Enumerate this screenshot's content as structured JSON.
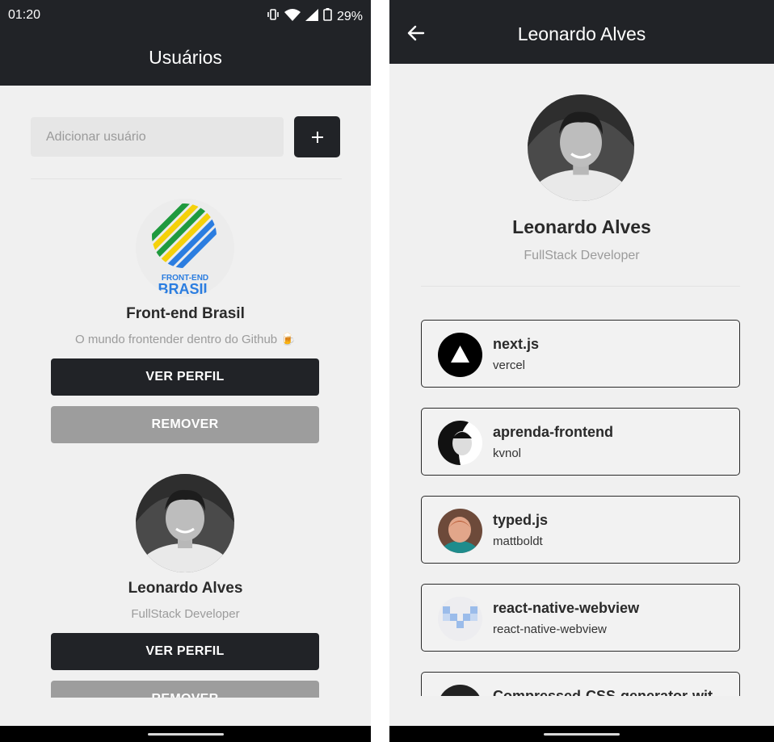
{
  "left": {
    "status": {
      "time": "01:20",
      "battery": "29%"
    },
    "title": "Usuários",
    "add_placeholder": "Adicionar usuário",
    "add_icon": "plus-icon",
    "users": [
      {
        "name": "Front-end Brasil",
        "description": "O mundo frontender dentro do Github 🍺",
        "view_label": "VER PERFIL",
        "remove_label": "REMOVER",
        "logo_text_1": "FRONT-END",
        "logo_text_2": "BRASIL"
      },
      {
        "name": "Leonardo Alves",
        "description": "FullStack Developer",
        "view_label": "VER PERFIL",
        "remove_label": "REMOVER"
      }
    ]
  },
  "right": {
    "title": "Leonardo Alves",
    "back_icon": "arrow-left-icon",
    "profile": {
      "name": "Leonardo Alves",
      "description": "FullStack Developer"
    },
    "repos": [
      {
        "name": "next.js",
        "owner": "vercel"
      },
      {
        "name": "aprenda-frontend",
        "owner": "kvnol"
      },
      {
        "name": "typed.js",
        "owner": "mattboldt"
      },
      {
        "name": "react-native-webview",
        "owner": "react-native-webview"
      },
      {
        "name": "Compressed-CSS-generator-wit",
        "owner": ""
      }
    ]
  },
  "colors": {
    "header": "#212327",
    "background": "#f0f0f0",
    "remove_button": "#9d9d9d"
  }
}
